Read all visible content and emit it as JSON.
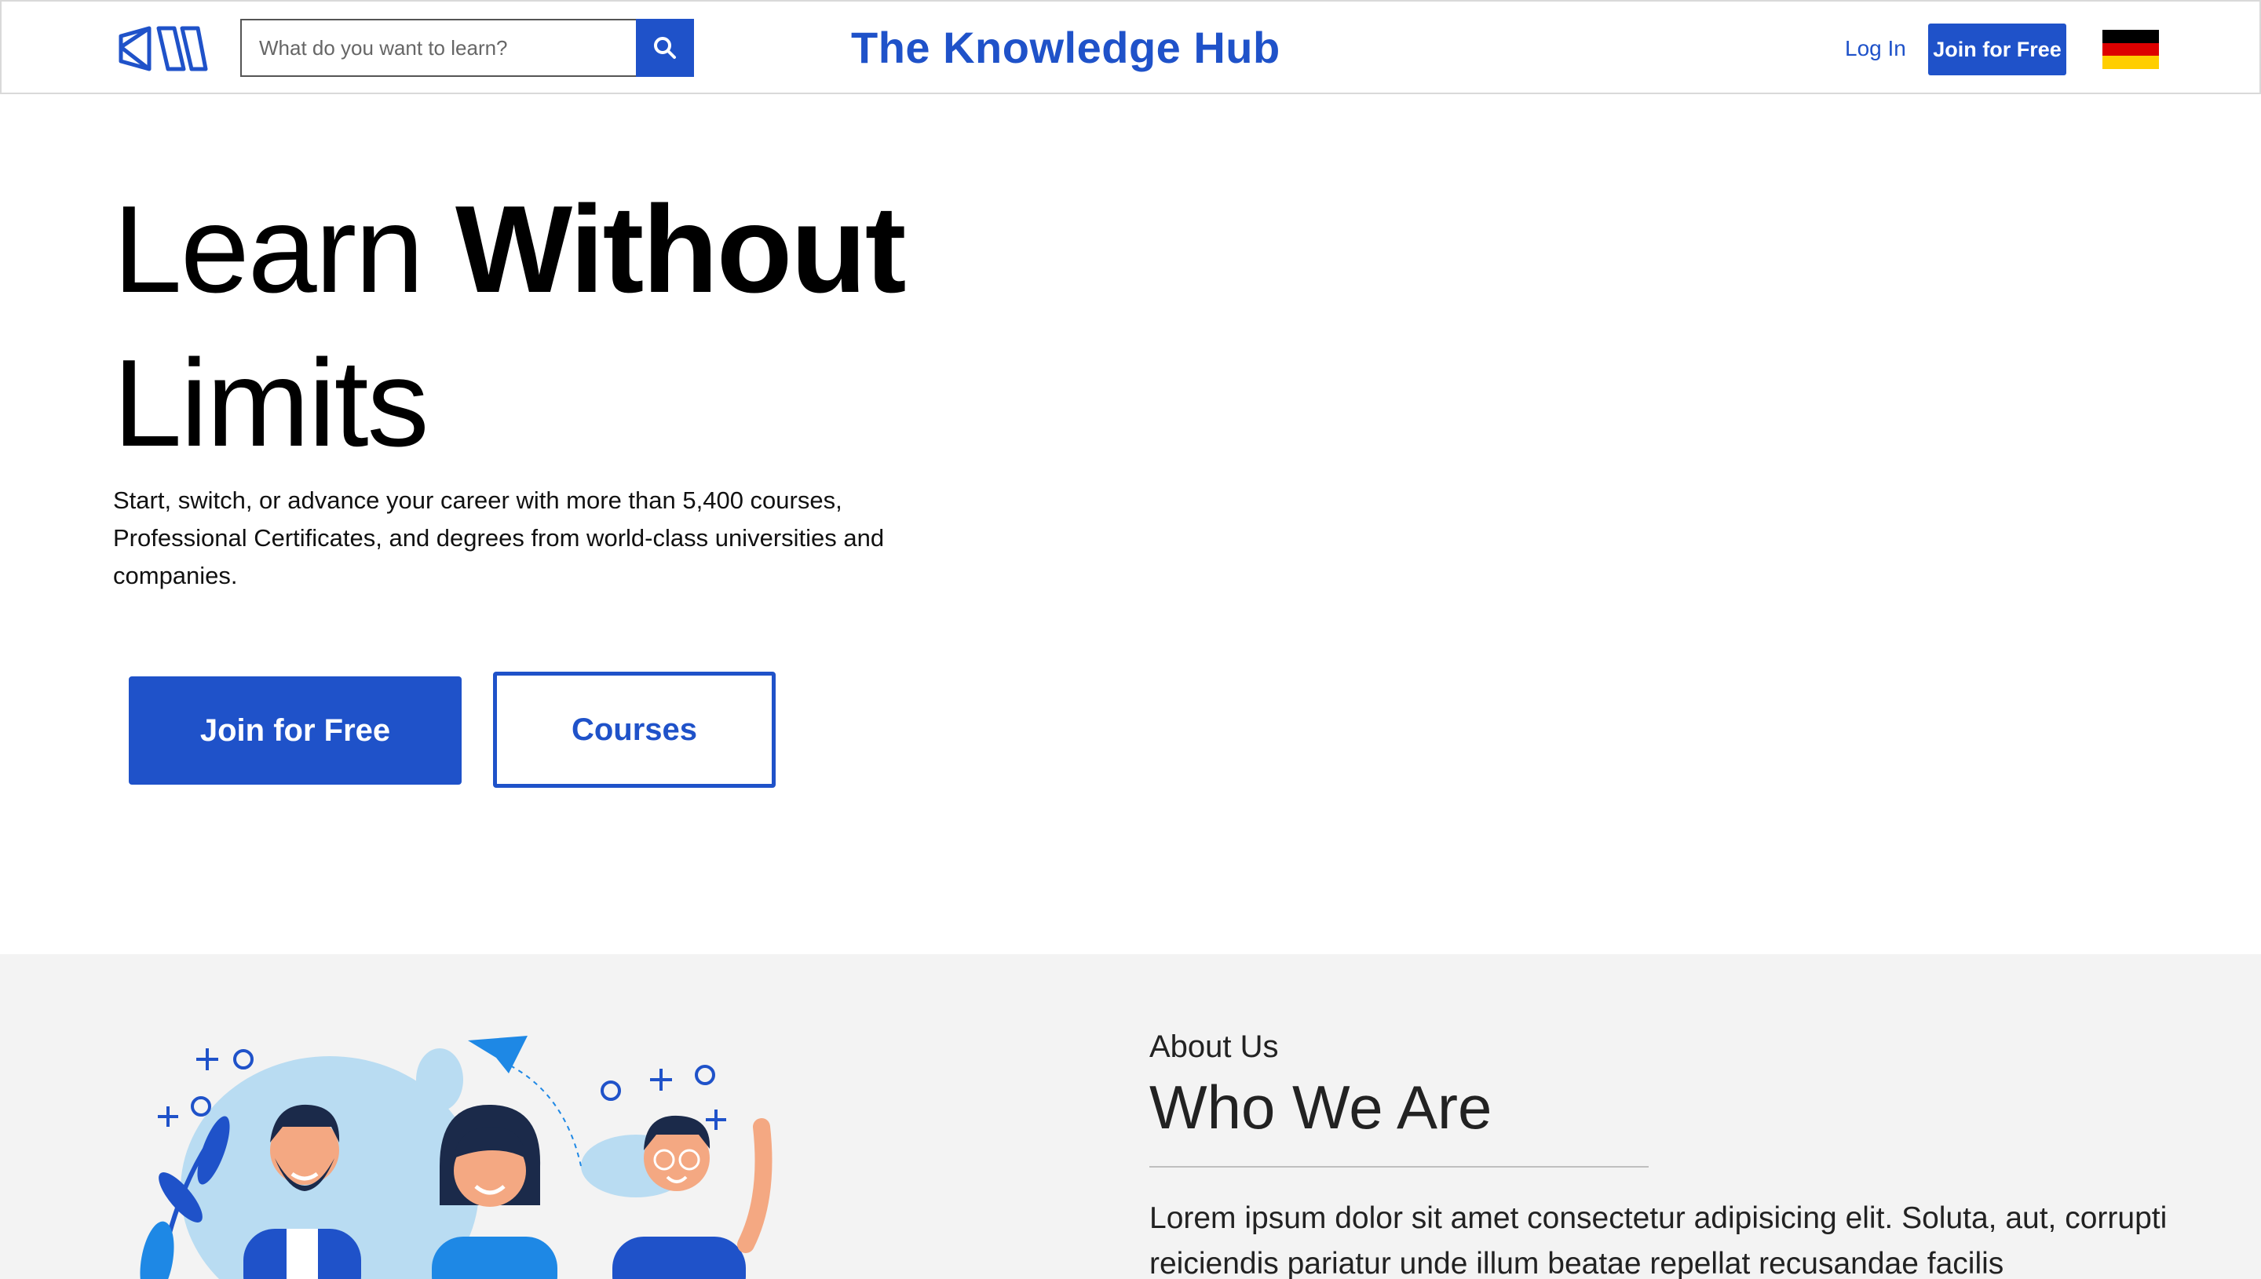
{
  "header": {
    "logo_icon": "book-logo-icon",
    "search": {
      "placeholder": "What do you want to learn?",
      "value": "",
      "button_icon": "search-icon"
    },
    "site_title": "The Knowledge Hub",
    "login_label": "Log In",
    "join_label": "Join for Free",
    "language_flag": "german-flag-icon"
  },
  "hero": {
    "title_light_1": "Learn",
    "title_bold_1": "Without",
    "title_light_2": "Limits",
    "description": "Start, switch, or advance your career with more than 5,400 courses, Professional Certificates, and degrees from world-class universities and companies.",
    "primary_button": "Join for Free",
    "secondary_button": "Courses"
  },
  "about": {
    "kicker": "About Us",
    "title": "Who We Are",
    "text": "Lorem ipsum dolor sit amet consectetur adipisicing elit. Soluta, aut, corrupti reiciendis pariatur unde illum beatae repellat recusandae facilis",
    "illustration": "team-people-illustration"
  },
  "colors": {
    "brand": "#1f52c9",
    "section_bg": "#f3f3f3",
    "flag_black": "#000000",
    "flag_red": "#dd0000",
    "flag_gold": "#ffce00"
  }
}
